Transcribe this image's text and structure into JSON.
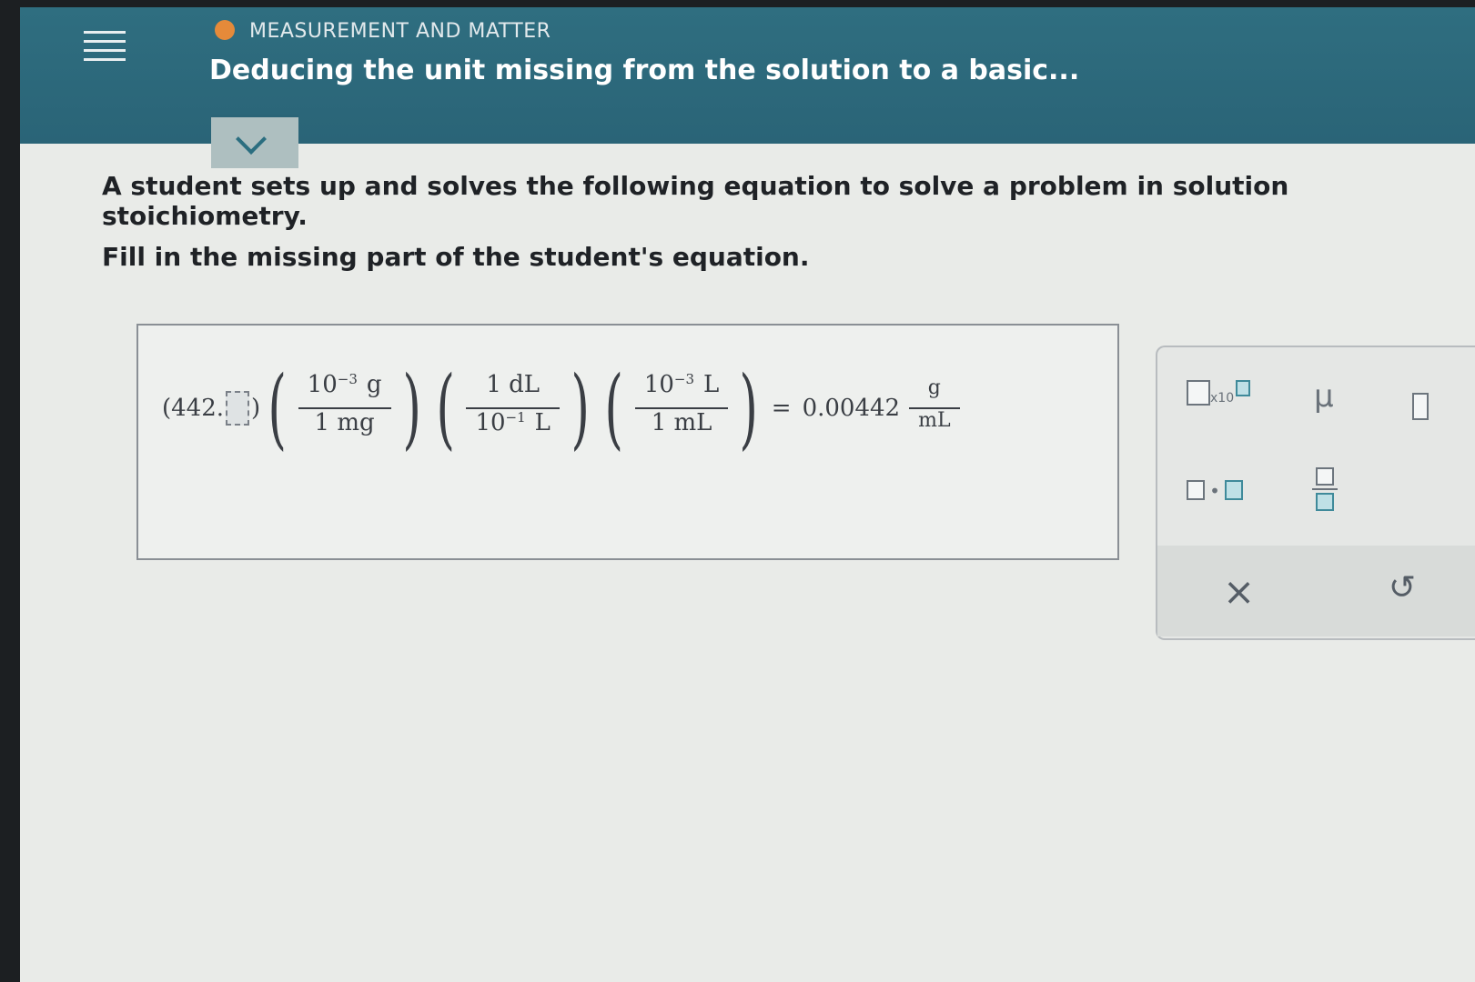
{
  "header": {
    "topic": "MEASUREMENT AND MATTER",
    "title": "Deducing the unit missing from the solution to a basic..."
  },
  "problem": {
    "line1": "A student sets up and solves the following equation to solve a problem in solution stoichiometry.",
    "line2": "Fill in the missing part of the student's equation."
  },
  "equation": {
    "lead_value": "(442.",
    "lead_close": ")",
    "factor1": {
      "num_base": "10",
      "num_exp": "−3",
      "num_unit": "g",
      "den": "1 mg"
    },
    "factor2": {
      "num": "1 dL",
      "den_base": "10",
      "den_exp": "−1",
      "den_unit": "L"
    },
    "factor3": {
      "num_base": "10",
      "num_exp": "−3",
      "num_unit": "L",
      "den": "1 mL"
    },
    "equals": "=",
    "result": "0.00442",
    "result_unit_num": "g",
    "result_unit_den": "mL"
  },
  "tools": {
    "sci_x10": "x10",
    "mu": "μ",
    "clear": "×",
    "undo": "↺"
  }
}
